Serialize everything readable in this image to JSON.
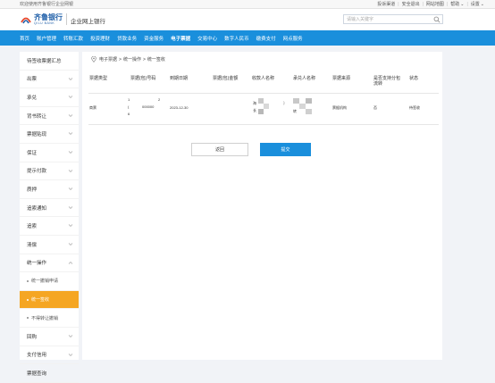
{
  "topbar": {
    "welcome": "欢迎使用齐鲁银行企业网银",
    "links": [
      "投诉渠道",
      "安全退出",
      "网站地图",
      "帮助",
      "设置"
    ]
  },
  "header": {
    "bank_name_cn": "齐鲁银行",
    "bank_name_en": "QILU BANK",
    "system_title": "企业网上银行",
    "search_placeholder": "请输入关键字"
  },
  "nav": {
    "items": [
      "首页",
      "账户管理",
      "转账汇款",
      "投资理财",
      "贷款业务",
      "资金服务",
      "电子票据",
      "交易中心",
      "数字人民币",
      "缴费支付",
      "网点服务"
    ],
    "active": "电子票据"
  },
  "sidebar": {
    "items": [
      {
        "label": "待签收票据汇总",
        "type": "title"
      },
      {
        "label": "出票",
        "type": "group"
      },
      {
        "label": "承兑",
        "type": "group"
      },
      {
        "label": "背书转让",
        "type": "group"
      },
      {
        "label": "票据贴现",
        "type": "group"
      },
      {
        "label": "保证",
        "type": "group"
      },
      {
        "label": "提示付款",
        "type": "group"
      },
      {
        "label": "质押",
        "type": "group"
      },
      {
        "label": "追索通知",
        "type": "group"
      },
      {
        "label": "追索",
        "type": "group"
      },
      {
        "label": "清偿",
        "type": "group"
      },
      {
        "label": "统一操作",
        "type": "group"
      },
      {
        "label": "统一撤销申请",
        "type": "sub"
      },
      {
        "label": "统一签收",
        "type": "sub-active"
      },
      {
        "label": "不得转让撤销",
        "type": "sub"
      },
      {
        "label": "回购",
        "type": "group"
      },
      {
        "label": "支付信用",
        "type": "group"
      },
      {
        "label": "票据查询",
        "type": "group"
      }
    ]
  },
  "breadcrumb": [
    "电子票据",
    "统一操作",
    "统一签收"
  ],
  "table": {
    "headers": [
      "票据类型",
      "票据(包)号码",
      "到期日期",
      "票据(包)金额",
      "收款人名称",
      "承兑人名称",
      "票据来源",
      "是否支持分包流转",
      "状态"
    ],
    "rows": [
      {
        "type": "商票",
        "number_line1": "1",
        "number_line2": "(",
        "number_line3": "6",
        "number_amount_fragment": "2",
        "number_sub": "000000 ",
        "number_sub2": "",
        "due_date": "2023-12-30",
        "amount": "",
        "payee_prefix": "海",
        "payee_suffix": "长",
        "acceptor_prefix": "",
        "acceptor_suffix": "转",
        "source": "票据机构",
        "split": "否",
        "status": "待签收"
      }
    ]
  },
  "buttons": {
    "back": "返回",
    "submit": "提交"
  },
  "colors": {
    "nav_blue": "#1a8fdc",
    "active_orange": "#f5a623",
    "brand_blue": "#1e5ea8"
  }
}
